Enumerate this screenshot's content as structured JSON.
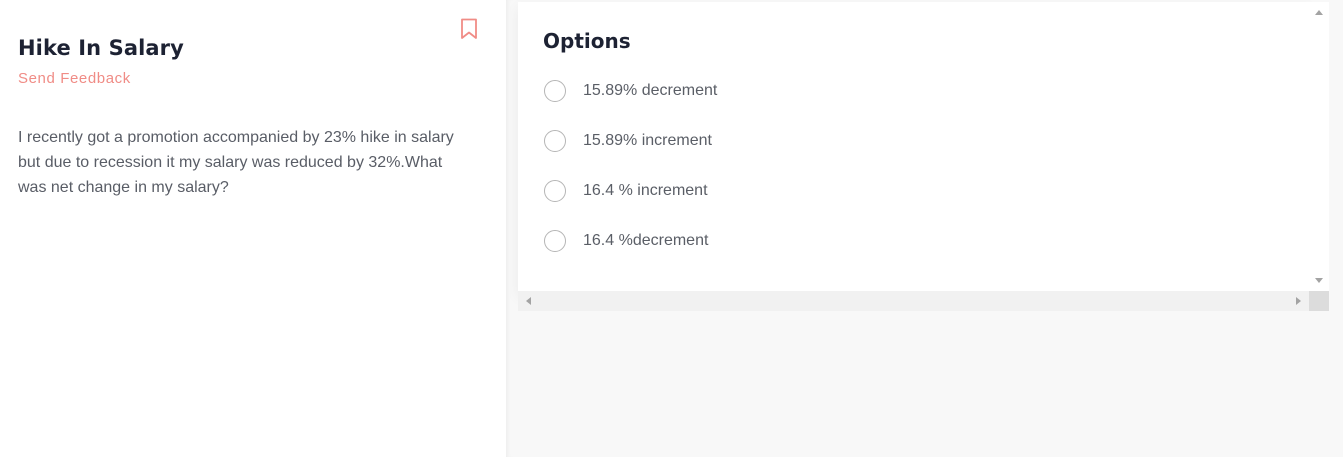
{
  "question": {
    "title": "Hike In Salary",
    "feedback_label": "Send Feedback",
    "text": "I recently got a promotion accompanied by 23% hike in salary but due to recession it my salary was reduced by 32%.What was net change in my salary?",
    "bookmark_icon": "bookmark-icon"
  },
  "options": {
    "title": "Options",
    "items": [
      {
        "label": "15.89% decrement",
        "selected": false
      },
      {
        "label": "15.89% increment",
        "selected": false
      },
      {
        "label": "16.4 % increment",
        "selected": false
      },
      {
        "label": "16.4 %decrement",
        "selected": false
      }
    ]
  },
  "colors": {
    "accent": "#f08c86",
    "title": "#1d2233",
    "body_text": "#595d66",
    "radio_border": "#b5b5b5",
    "panel_bg": "#f8f8f8"
  }
}
